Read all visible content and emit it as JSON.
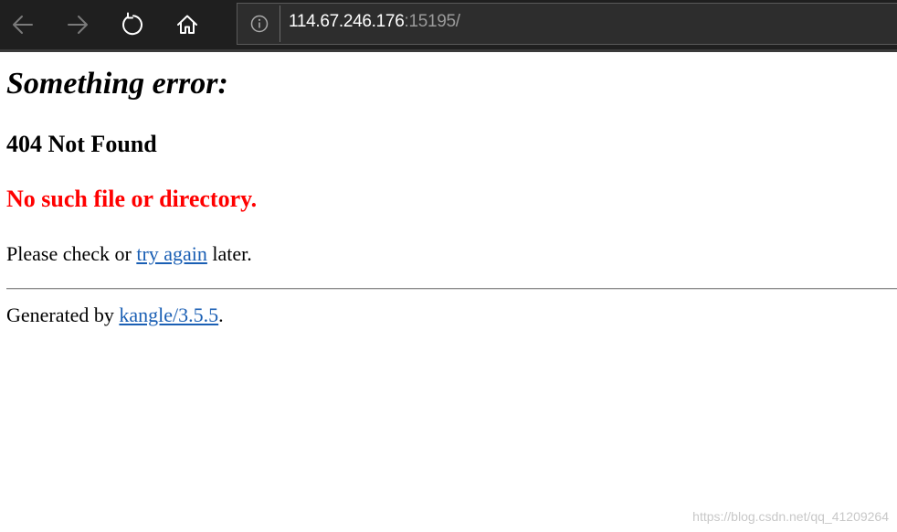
{
  "browser": {
    "url_host": "114.67.246.176",
    "url_rest": ":15195/",
    "icons": {
      "back": "back-arrow-icon",
      "forward": "forward-arrow-icon",
      "refresh": "refresh-icon",
      "home": "home-icon",
      "info": "info-icon"
    },
    "colors": {
      "toolbar_bg": "#1f1f1f",
      "address_bg": "#2d2d2d",
      "url_host": "#ffffff",
      "url_rest": "#9a9a9a"
    }
  },
  "page": {
    "error_heading": "Something error:",
    "status_heading": "404 Not Found",
    "message": "No such file or directory.",
    "hint_prefix": "Please check or ",
    "hint_link": "try again",
    "hint_suffix": " later.",
    "footer_prefix": "Generated by ",
    "footer_link": "kangle/3.5.5",
    "footer_suffix": ".",
    "colors": {
      "message": "#ff0000",
      "link": "#1a5fb4"
    }
  },
  "watermark": "https://blog.csdn.net/qq_41209264"
}
